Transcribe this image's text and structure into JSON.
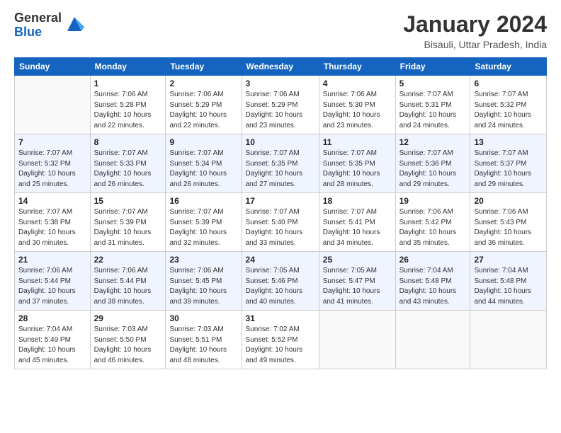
{
  "header": {
    "logo_general": "General",
    "logo_blue": "Blue",
    "title": "January 2024",
    "location": "Bisauli, Uttar Pradesh, India"
  },
  "weekdays": [
    "Sunday",
    "Monday",
    "Tuesday",
    "Wednesday",
    "Thursday",
    "Friday",
    "Saturday"
  ],
  "weeks": [
    [
      {
        "date": "",
        "info": ""
      },
      {
        "date": "1",
        "info": "Sunrise: 7:06 AM\nSunset: 5:28 PM\nDaylight: 10 hours\nand 22 minutes."
      },
      {
        "date": "2",
        "info": "Sunrise: 7:06 AM\nSunset: 5:29 PM\nDaylight: 10 hours\nand 22 minutes."
      },
      {
        "date": "3",
        "info": "Sunrise: 7:06 AM\nSunset: 5:29 PM\nDaylight: 10 hours\nand 23 minutes."
      },
      {
        "date": "4",
        "info": "Sunrise: 7:06 AM\nSunset: 5:30 PM\nDaylight: 10 hours\nand 23 minutes."
      },
      {
        "date": "5",
        "info": "Sunrise: 7:07 AM\nSunset: 5:31 PM\nDaylight: 10 hours\nand 24 minutes."
      },
      {
        "date": "6",
        "info": "Sunrise: 7:07 AM\nSunset: 5:32 PM\nDaylight: 10 hours\nand 24 minutes."
      }
    ],
    [
      {
        "date": "7",
        "info": "Sunrise: 7:07 AM\nSunset: 5:32 PM\nDaylight: 10 hours\nand 25 minutes."
      },
      {
        "date": "8",
        "info": "Sunrise: 7:07 AM\nSunset: 5:33 PM\nDaylight: 10 hours\nand 26 minutes."
      },
      {
        "date": "9",
        "info": "Sunrise: 7:07 AM\nSunset: 5:34 PM\nDaylight: 10 hours\nand 26 minutes."
      },
      {
        "date": "10",
        "info": "Sunrise: 7:07 AM\nSunset: 5:35 PM\nDaylight: 10 hours\nand 27 minutes."
      },
      {
        "date": "11",
        "info": "Sunrise: 7:07 AM\nSunset: 5:35 PM\nDaylight: 10 hours\nand 28 minutes."
      },
      {
        "date": "12",
        "info": "Sunrise: 7:07 AM\nSunset: 5:36 PM\nDaylight: 10 hours\nand 29 minutes."
      },
      {
        "date": "13",
        "info": "Sunrise: 7:07 AM\nSunset: 5:37 PM\nDaylight: 10 hours\nand 29 minutes."
      }
    ],
    [
      {
        "date": "14",
        "info": "Sunrise: 7:07 AM\nSunset: 5:38 PM\nDaylight: 10 hours\nand 30 minutes."
      },
      {
        "date": "15",
        "info": "Sunrise: 7:07 AM\nSunset: 5:39 PM\nDaylight: 10 hours\nand 31 minutes."
      },
      {
        "date": "16",
        "info": "Sunrise: 7:07 AM\nSunset: 5:39 PM\nDaylight: 10 hours\nand 32 minutes."
      },
      {
        "date": "17",
        "info": "Sunrise: 7:07 AM\nSunset: 5:40 PM\nDaylight: 10 hours\nand 33 minutes."
      },
      {
        "date": "18",
        "info": "Sunrise: 7:07 AM\nSunset: 5:41 PM\nDaylight: 10 hours\nand 34 minutes."
      },
      {
        "date": "19",
        "info": "Sunrise: 7:06 AM\nSunset: 5:42 PM\nDaylight: 10 hours\nand 35 minutes."
      },
      {
        "date": "20",
        "info": "Sunrise: 7:06 AM\nSunset: 5:43 PM\nDaylight: 10 hours\nand 36 minutes."
      }
    ],
    [
      {
        "date": "21",
        "info": "Sunrise: 7:06 AM\nSunset: 5:44 PM\nDaylight: 10 hours\nand 37 minutes."
      },
      {
        "date": "22",
        "info": "Sunrise: 7:06 AM\nSunset: 5:44 PM\nDaylight: 10 hours\nand 38 minutes."
      },
      {
        "date": "23",
        "info": "Sunrise: 7:06 AM\nSunset: 5:45 PM\nDaylight: 10 hours\nand 39 minutes."
      },
      {
        "date": "24",
        "info": "Sunrise: 7:05 AM\nSunset: 5:46 PM\nDaylight: 10 hours\nand 40 minutes."
      },
      {
        "date": "25",
        "info": "Sunrise: 7:05 AM\nSunset: 5:47 PM\nDaylight: 10 hours\nand 41 minutes."
      },
      {
        "date": "26",
        "info": "Sunrise: 7:04 AM\nSunset: 5:48 PM\nDaylight: 10 hours\nand 43 minutes."
      },
      {
        "date": "27",
        "info": "Sunrise: 7:04 AM\nSunset: 5:48 PM\nDaylight: 10 hours\nand 44 minutes."
      }
    ],
    [
      {
        "date": "28",
        "info": "Sunrise: 7:04 AM\nSunset: 5:49 PM\nDaylight: 10 hours\nand 45 minutes."
      },
      {
        "date": "29",
        "info": "Sunrise: 7:03 AM\nSunset: 5:50 PM\nDaylight: 10 hours\nand 46 minutes."
      },
      {
        "date": "30",
        "info": "Sunrise: 7:03 AM\nSunset: 5:51 PM\nDaylight: 10 hours\nand 48 minutes."
      },
      {
        "date": "31",
        "info": "Sunrise: 7:02 AM\nSunset: 5:52 PM\nDaylight: 10 hours\nand 49 minutes."
      },
      {
        "date": "",
        "info": ""
      },
      {
        "date": "",
        "info": ""
      },
      {
        "date": "",
        "info": ""
      }
    ]
  ]
}
